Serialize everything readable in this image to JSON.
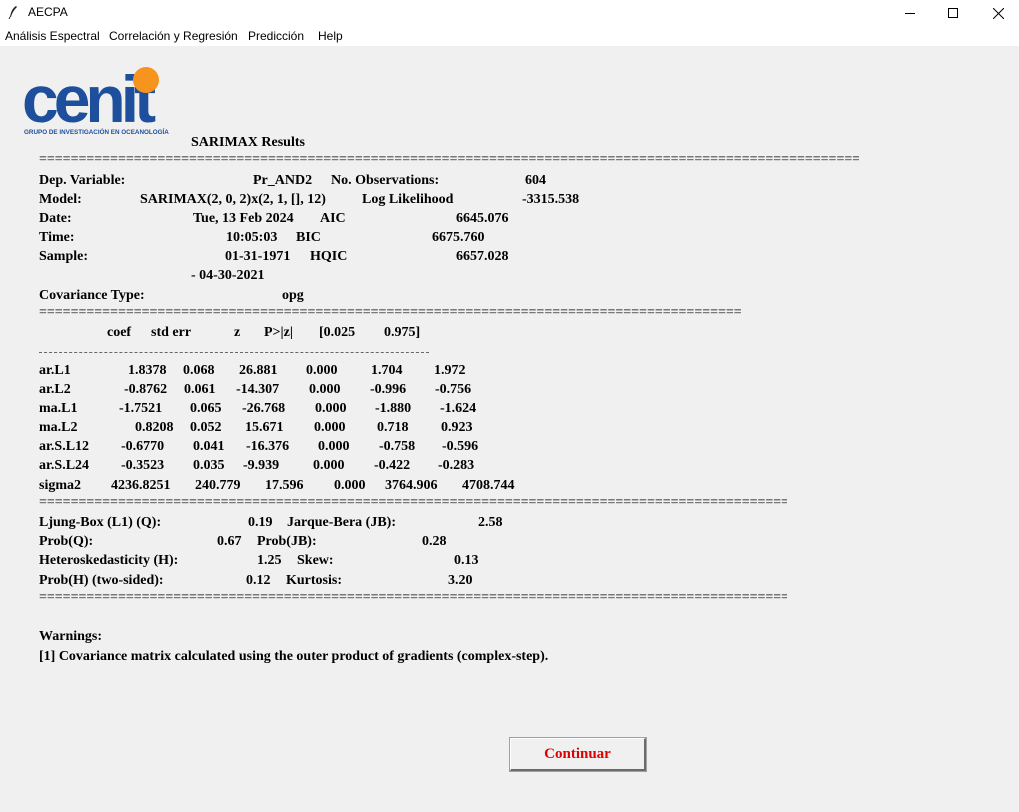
{
  "window": {
    "title": "AECPA"
  },
  "menu": [
    "Análisis Espectral",
    "Correlación y Regresión",
    "Predicción",
    "Help"
  ],
  "logo": {
    "brand": "cenit",
    "tagline": "GRUPO DE INVESTIGACIÓN EN OCEANOLOGÍA",
    "accent_color": "#f7941d",
    "brand_color": "#1d4f9c"
  },
  "report": {
    "heading": "SARIMAX Results",
    "info": {
      "dep_var_label": "Dep. Variable:",
      "dep_var": "Pr_AND2",
      "nobs_label": "No. Observations:",
      "nobs": "604",
      "model_label": "Model:",
      "model": "SARIMAX(2, 0, 2)x(2, 1, [], 12)",
      "loglik_label": "Log Likelihood",
      "loglik": "-3315.538",
      "date_label": "Date:",
      "date": "Tue, 13 Feb 2024",
      "aic_label": "AIC",
      "aic": "6645.076",
      "time_label": "Time:",
      "time": "10:05:03",
      "bic_label": "BIC",
      "bic": "6675.760",
      "sample_label": "Sample:",
      "sample_start": "01-31-1971",
      "hqic_label": "HQIC",
      "hqic": "6657.028",
      "sample_end": "- 04-30-2021",
      "cov_label": "Covariance Type:",
      "cov": "opg"
    },
    "coef_header": [
      "coef",
      "std err",
      "z",
      "P>|z|",
      "[0.025",
      "0.975]"
    ],
    "coef_rows": [
      [
        "ar.L1",
        "1.8378",
        "0.068",
        "26.881",
        "0.000",
        "1.704",
        "1.972"
      ],
      [
        "ar.L2",
        "-0.8762",
        "0.061",
        "-14.307",
        "0.000",
        "-0.996",
        "-0.756"
      ],
      [
        "ma.L1",
        "-1.7521",
        "0.065",
        "-26.768",
        "0.000",
        "-1.880",
        "-1.624"
      ],
      [
        "ma.L2",
        "0.8208",
        "0.052",
        "15.671",
        "0.000",
        "0.718",
        "0.923"
      ],
      [
        "ar.S.L12",
        "-0.6770",
        "0.041",
        "-16.376",
        "0.000",
        "-0.758",
        "-0.596"
      ],
      [
        "ar.S.L24",
        "-0.3523",
        "0.035",
        "-9.939",
        "0.000",
        "-0.422",
        "-0.283"
      ],
      [
        "sigma2",
        "4236.8251",
        "240.779",
        "17.596",
        "0.000",
        "3764.906",
        "4708.744"
      ]
    ],
    "diagnostics": {
      "ljung_label": "Ljung-Box (L1) (Q):",
      "ljung": "0.19",
      "jb_label": "Jarque-Bera (JB):",
      "jb": "2.58",
      "probq_label": "Prob(Q):",
      "probq": "0.67",
      "probjb_label": "Prob(JB):",
      "probjb": "0.28",
      "het_label": "Heteroskedasticity (H):",
      "het": "1.25",
      "skew_label": "Skew:",
      "skew": "0.13",
      "probh_label": "Prob(H) (two-sided):",
      "probh": "0.12",
      "kurt_label": "Kurtosis:",
      "kurt": "3.20"
    },
    "warnings_title": "Warnings:",
    "warning_1": "[1] Covariance matrix calculated using the outer product of gradients (complex-step)."
  },
  "buttons": {
    "continue": "Continuar"
  },
  "rules": {
    "long": "=====================================================================================================================================================================",
    "mid": "==========================================================================================================================================================",
    "short": "================================================================================================================================"
  }
}
